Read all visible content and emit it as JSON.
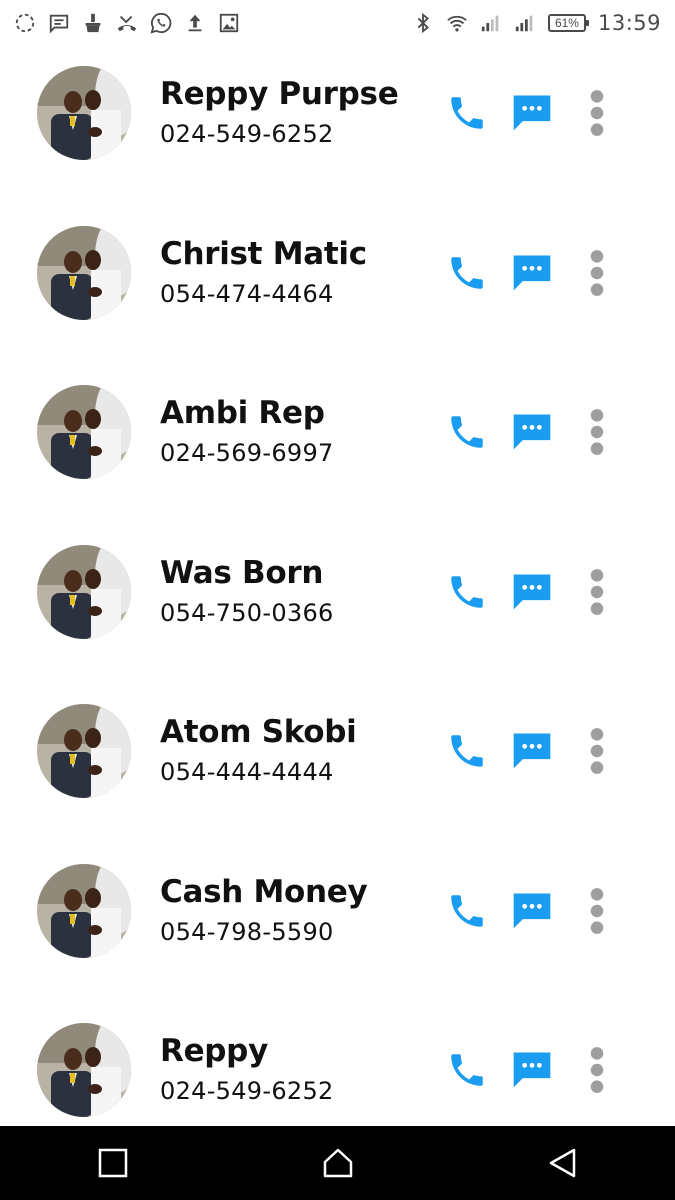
{
  "status_bar": {
    "left_icons": [
      "sync-icon",
      "message-icon",
      "cleaner-icon",
      "missed-call-icon",
      "whatsapp-icon",
      "upload-icon",
      "image-icon"
    ],
    "right_icons": [
      "bluetooth-icon",
      "wifi-icon",
      "signal-icon",
      "signal-icon"
    ],
    "battery": "61%",
    "time": "13:59"
  },
  "contacts": [
    {
      "name": "Reppy Purpse",
      "phone": "024-549-6252"
    },
    {
      "name": "Christ Matic",
      "phone": "054-474-4464"
    },
    {
      "name": "Ambi Rep",
      "phone": "024-569-6997"
    },
    {
      "name": "Was Born",
      "phone": "054-750-0366"
    },
    {
      "name": "Atom Skobi",
      "phone": "054-444-4444"
    },
    {
      "name": "Cash Money",
      "phone": "054-798-5590"
    },
    {
      "name": "Reppy",
      "phone": "024-549-6252"
    }
  ],
  "colors": {
    "accent": "#1a9cf0",
    "more_icon": "#9e9e9e",
    "text": "#111111",
    "status_text": "#4a4a4a",
    "nav_bg": "#000000"
  },
  "nav_bar": {
    "icons": [
      "recents-icon",
      "home-icon",
      "back-icon"
    ]
  }
}
